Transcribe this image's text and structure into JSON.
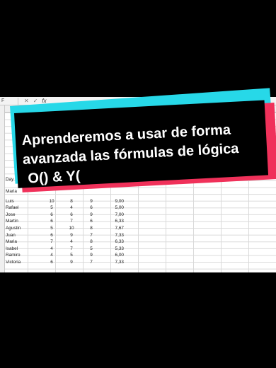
{
  "formula_bar": {
    "name_box": "F",
    "cancel": "✕",
    "enter": "✓",
    "fx": "fx"
  },
  "rows": [
    {
      "name": "Luis",
      "n1": "10",
      "n2": "8",
      "n3": "9",
      "avg": "9,00"
    },
    {
      "name": "Rafael",
      "n1": "5",
      "n2": "4",
      "n3": "6",
      "avg": "5,00"
    },
    {
      "name": "Jose",
      "n1": "6",
      "n2": "6",
      "n3": "9",
      "avg": "7,00"
    },
    {
      "name": "Martin",
      "n1": "6",
      "n2": "7",
      "n3": "6",
      "avg": "6,33"
    },
    {
      "name": "Agustin",
      "n1": "5",
      "n2": "10",
      "n3": "8",
      "avg": "7,67"
    },
    {
      "name": "Juan",
      "n1": "6",
      "n2": "9",
      "n3": "7",
      "avg": "7,33"
    },
    {
      "name": "Maria",
      "n1": "7",
      "n2": "4",
      "n3": "8",
      "avg": "6,33"
    },
    {
      "name": "Isabel",
      "n1": "4",
      "n2": "7",
      "n3": "5",
      "avg": "5,33"
    },
    {
      "name": "Ramiro",
      "n1": "4",
      "n2": "5",
      "n3": "9",
      "avg": "6,00"
    },
    {
      "name": "Victoria",
      "n1": "6",
      "n2": "9",
      "n3": "7",
      "avg": "7,33"
    }
  ],
  "partial_rows": {
    "day": "Day",
    "maria": "Maria"
  },
  "caption": {
    "line1": "Aprenderemos a usar de forma",
    "line2": "avanzada las fórmulas de lógica",
    "line3": "O() & Y("
  },
  "colors": {
    "cyan": "#27d8e8",
    "red": "#f0315a",
    "black": "#000000"
  }
}
